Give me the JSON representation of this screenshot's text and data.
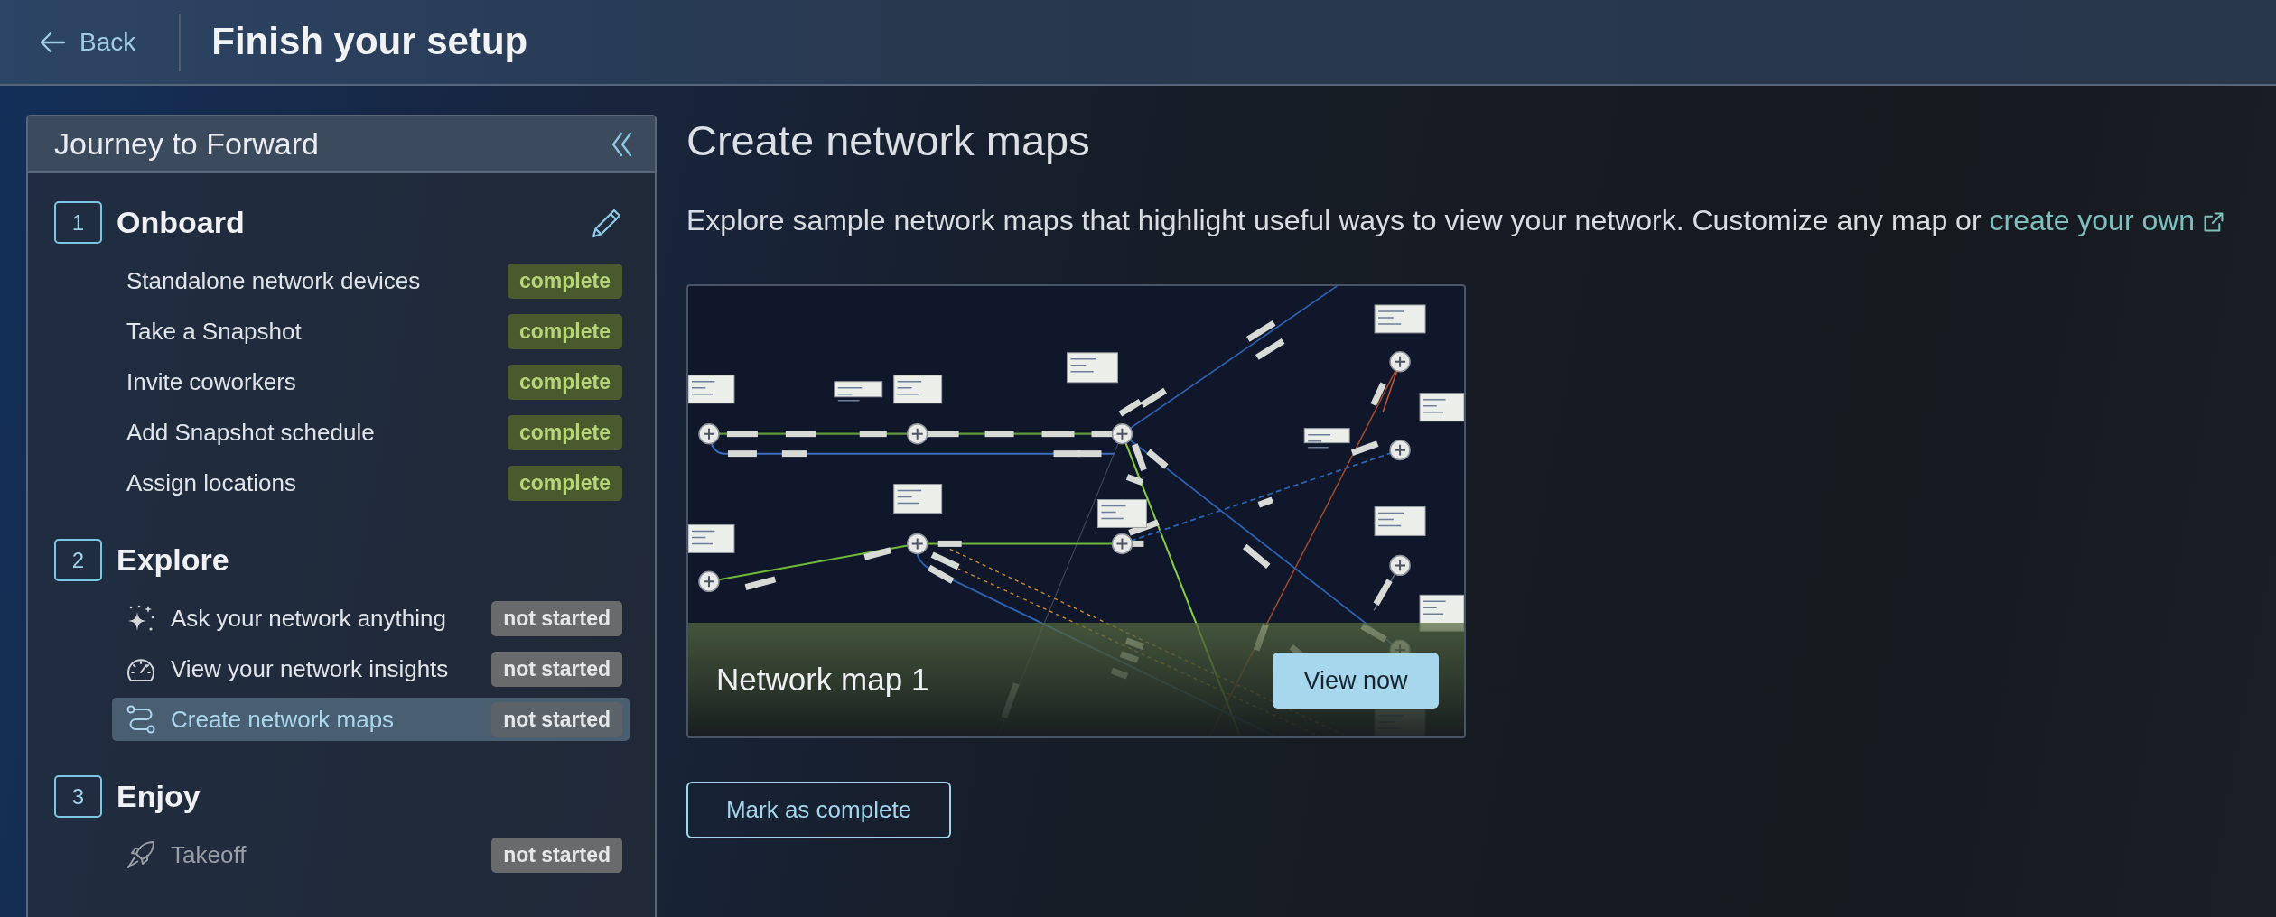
{
  "header": {
    "back": "Back",
    "title": "Finish your setup"
  },
  "sidebar": {
    "title": "Journey to Forward",
    "sections": [
      {
        "number": "1",
        "title": "Onboard",
        "items": [
          {
            "label": "Standalone network devices",
            "badge": "complete",
            "done": true,
            "selected": false,
            "disabled": false
          },
          {
            "label": "Take a Snapshot",
            "badge": "complete",
            "done": true,
            "selected": false,
            "disabled": false
          },
          {
            "label": "Invite coworkers",
            "badge": "complete",
            "done": true,
            "selected": false,
            "disabled": false
          },
          {
            "label": "Add Snapshot schedule",
            "badge": "complete",
            "done": true,
            "selected": false,
            "disabled": false
          },
          {
            "label": "Assign locations",
            "badge": "complete",
            "done": true,
            "selected": false,
            "disabled": false
          }
        ]
      },
      {
        "number": "2",
        "title": "Explore",
        "items": [
          {
            "label": "Ask your network anything",
            "badge": "not started",
            "done": false,
            "selected": false,
            "disabled": false
          },
          {
            "label": "View your network insights",
            "badge": "not started",
            "done": false,
            "selected": false,
            "disabled": false
          },
          {
            "label": "Create network maps",
            "badge": "not started",
            "done": false,
            "selected": true,
            "disabled": false
          }
        ]
      },
      {
        "number": "3",
        "title": "Enjoy",
        "items": [
          {
            "label": "Takeoff",
            "badge": "not started",
            "done": false,
            "selected": false,
            "disabled": true
          }
        ]
      }
    ]
  },
  "main": {
    "title": "Create network maps",
    "description": "Explore sample network maps that highlight useful ways to view your network. Customize any map or",
    "link": "create your own",
    "maps": [
      {
        "title": "Network map 1",
        "button": "View now"
      }
    ],
    "complete_button": "Mark as complete"
  }
}
